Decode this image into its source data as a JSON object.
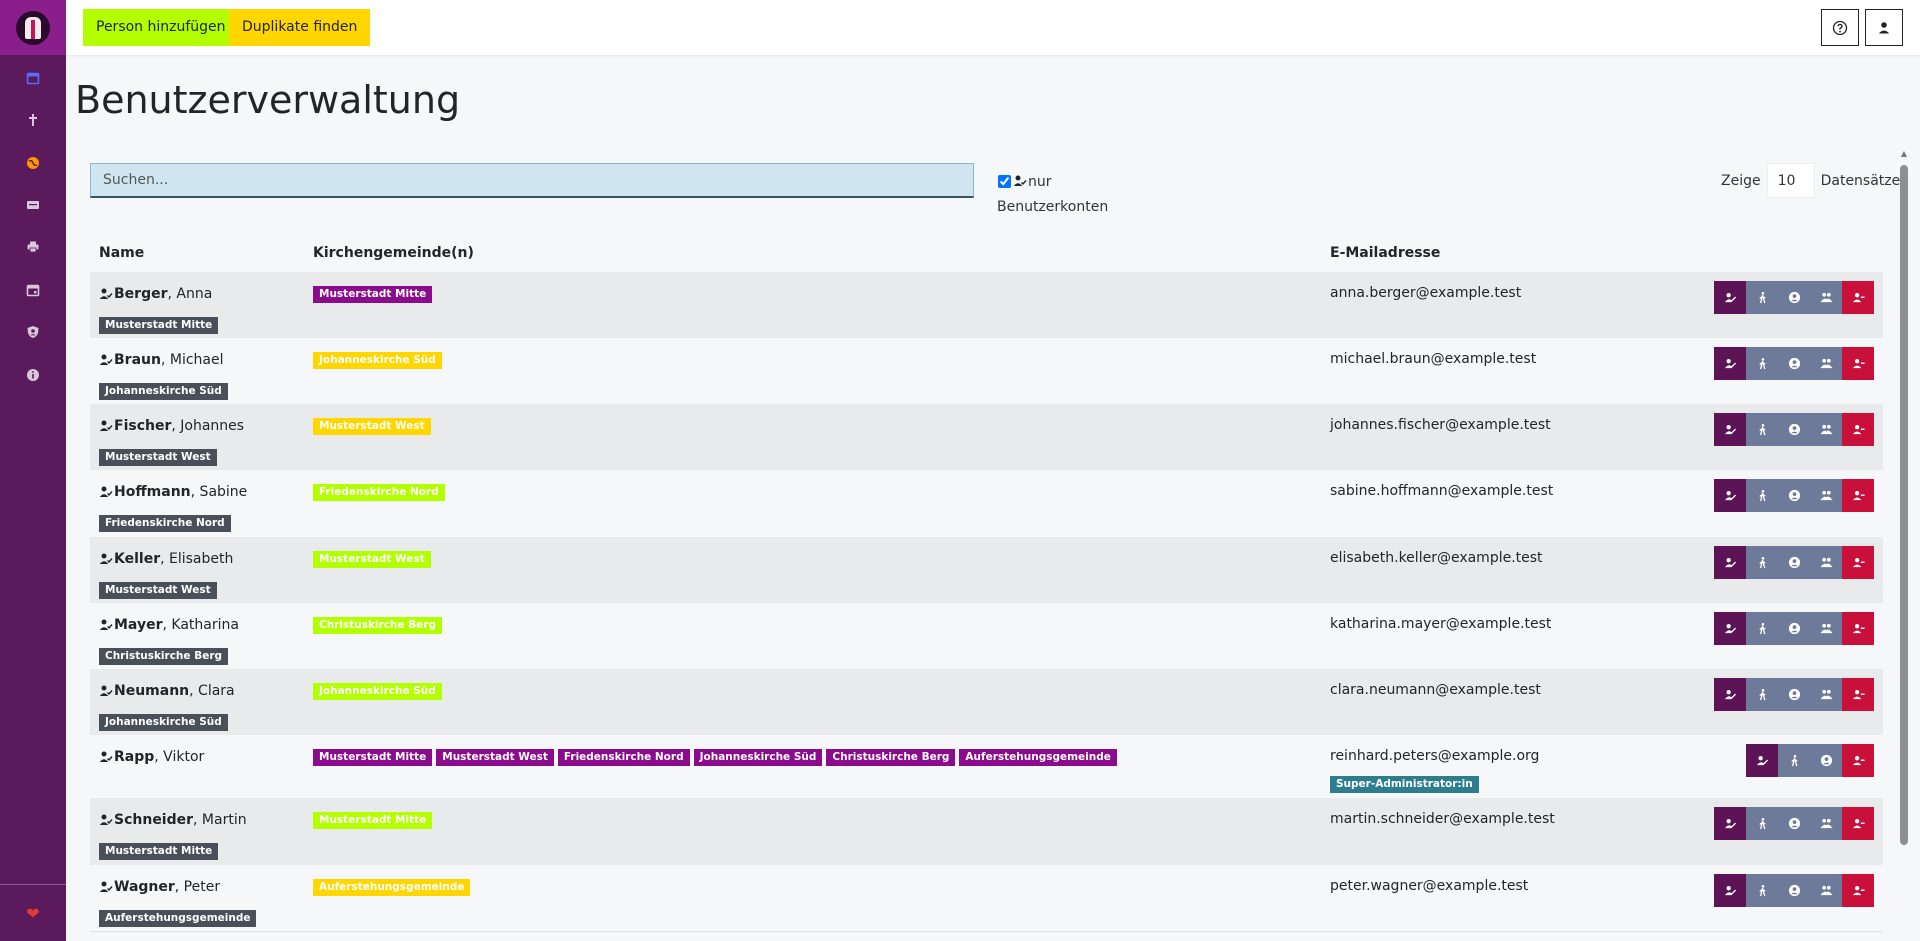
{
  "colors": {
    "sidebar": "#5a1a5c",
    "accent_lime": "#b3ff00",
    "accent_yellow": "#ffd600",
    "badge_purple": "#8a0b8c",
    "badge_gray": "#49505a",
    "badge_teal": "#2e7d8c",
    "action_edit": "#5c1457",
    "action_gray": "#6e7a9a",
    "action_delete": "#c8103a"
  },
  "sidebar": {
    "items": [
      {
        "icon": "calendar-icon"
      },
      {
        "icon": "cross-icon"
      },
      {
        "icon": "globe-icon"
      },
      {
        "icon": "id-card-icon"
      },
      {
        "icon": "printer-icon"
      },
      {
        "icon": "calendar-day-icon"
      },
      {
        "icon": "user-shield-icon"
      },
      {
        "icon": "info-icon"
      }
    ],
    "bottom_icon": "heart-icon"
  },
  "toolbar": {
    "add_person_label": "Person hinzufügen",
    "find_duplicates_label": "Duplikate finden",
    "help_icon": "help-icon",
    "account_icon": "user-account-icon"
  },
  "page": {
    "title": "Benutzerverwaltung"
  },
  "filters": {
    "search_placeholder": "Suchen...",
    "only_accounts_label_1": "nur",
    "only_accounts_label_2": "Benutzerkonten",
    "only_accounts_checked": true,
    "show_label": "Zeige",
    "page_size": "10",
    "records_label": "Datensätze"
  },
  "table": {
    "headers": {
      "name": "Name",
      "parishes": "Kirchengemeinde(n)",
      "email": "E-Mailadresse"
    },
    "rows": [
      {
        "last": "Berger",
        "first": ", Anna",
        "home": "Musterstadt Mitte",
        "parishes": [
          {
            "label": "Musterstadt Mitte",
            "color": "purple"
          }
        ],
        "email": "anna.berger@example.test",
        "role": "",
        "actions": 5
      },
      {
        "last": "Braun",
        "first": ", Michael",
        "home": "Johanneskirche Süd",
        "parishes": [
          {
            "label": "Johanneskirche Süd",
            "color": "yellow"
          }
        ],
        "email": "michael.braun@example.test",
        "role": "",
        "actions": 5
      },
      {
        "last": "Fischer",
        "first": ", Johannes",
        "home": "Musterstadt West",
        "parishes": [
          {
            "label": "Musterstadt West",
            "color": "yellow"
          }
        ],
        "email": "johannes.fischer@example.test",
        "role": "",
        "actions": 5
      },
      {
        "last": "Hoffmann",
        "first": ", Sabine",
        "home": "Friedenskirche Nord",
        "parishes": [
          {
            "label": "Friedenskirche Nord",
            "color": "lime"
          }
        ],
        "email": "sabine.hoffmann@example.test",
        "role": "",
        "actions": 5
      },
      {
        "last": "Keller",
        "first": ", Elisabeth",
        "home": "Musterstadt West",
        "parishes": [
          {
            "label": "Musterstadt West",
            "color": "lime"
          }
        ],
        "email": "elisabeth.keller@example.test",
        "role": "",
        "actions": 5
      },
      {
        "last": "Mayer",
        "first": ", Katharina",
        "home": "Christuskirche Berg",
        "parishes": [
          {
            "label": "Christuskirche Berg",
            "color": "lime"
          }
        ],
        "email": "katharina.mayer@example.test",
        "role": "",
        "actions": 5
      },
      {
        "last": "Neumann",
        "first": ", Clara",
        "home": "Johanneskirche Süd",
        "parishes": [
          {
            "label": "Johanneskirche Süd",
            "color": "lime"
          }
        ],
        "email": "clara.neumann@example.test",
        "role": "",
        "actions": 5
      },
      {
        "last": "Rapp",
        "first": ", Viktor",
        "home": "",
        "parishes": [
          {
            "label": "Musterstadt Mitte",
            "color": "purple"
          },
          {
            "label": "Musterstadt West",
            "color": "purple"
          },
          {
            "label": "Friedenskirche Nord",
            "color": "purple"
          },
          {
            "label": "Johanneskirche Süd",
            "color": "purple"
          },
          {
            "label": "Christuskirche Berg",
            "color": "purple"
          },
          {
            "label": "Auferstehungsgemeinde",
            "color": "purple"
          }
        ],
        "email": "reinhard.peters@example.org",
        "role": "Super-Administrator:in",
        "actions": 4
      },
      {
        "last": "Schneider",
        "first": ", Martin",
        "home": "Musterstadt Mitte",
        "parishes": [
          {
            "label": "Musterstadt Mitte",
            "color": "lime"
          }
        ],
        "email": "martin.schneider@example.test",
        "role": "",
        "actions": 5
      },
      {
        "last": "Wagner",
        "first": ", Peter",
        "home": "Auferstehungsgemeinde",
        "parishes": [
          {
            "label": "Auferstehungsgemeinde",
            "color": "yellow"
          }
        ],
        "email": "peter.wagner@example.test",
        "role": "",
        "actions": 5
      }
    ]
  }
}
